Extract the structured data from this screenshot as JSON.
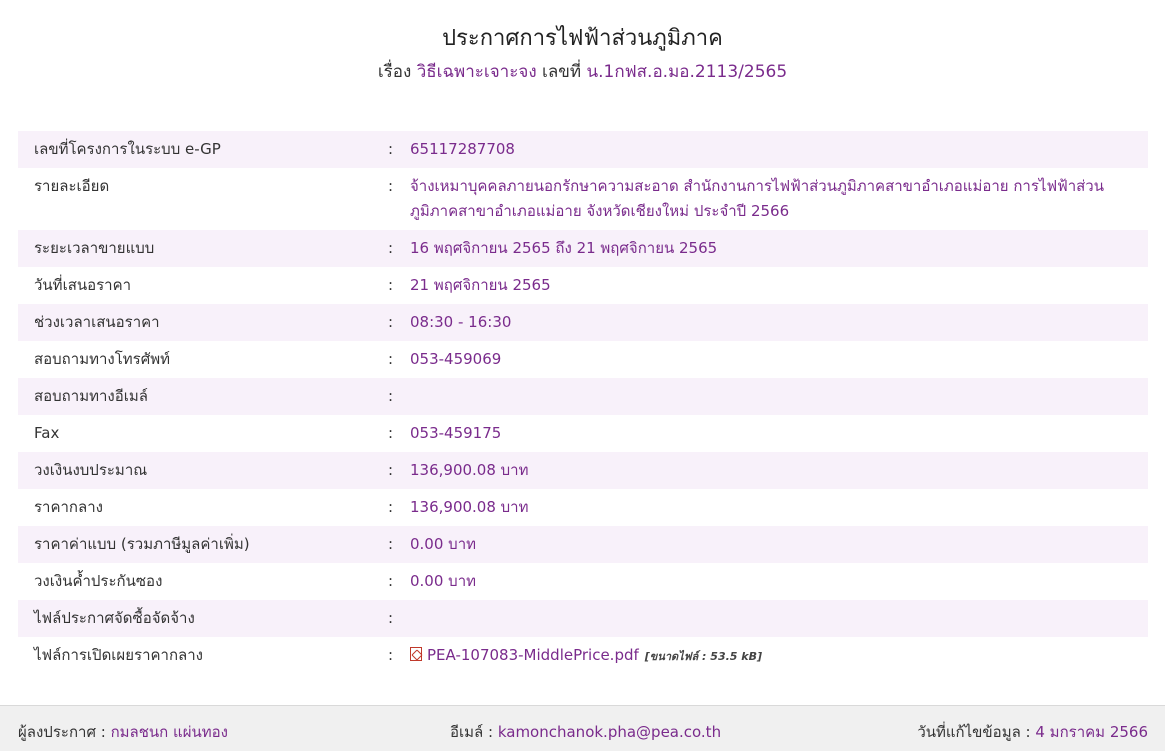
{
  "header": {
    "title": "ประกาศการไฟฟ้าส่วนภูมิภาค",
    "subject_prefix": "เรื่อง",
    "subject": "วิธีเฉพาะเจาะจง",
    "number_prefix": "เลขที่",
    "number": "น.1กฟส.อ.มอ.2113/2565"
  },
  "rows": [
    {
      "label": "เลขที่โครงการในระบบ e-GP",
      "colon": ":",
      "value": "65117287708"
    },
    {
      "label": "รายละเอียด",
      "colon": ":",
      "value": "จ้างเหมาบุคคลภายนอกรักษาความสะอาด สำนักงานการไฟฟ้าส่วนภูมิภาคสาขาอำเภอแม่อาย การไฟฟ้าส่วนภูมิภาคสาขาอำเภอแม่อาย จังหวัดเชียงใหม่ ประจำปี 2566"
    },
    {
      "label": "ระยะเวลาขายแบบ",
      "colon": ":",
      "value": "16 พฤศจิกายน 2565 ถึง 21 พฤศจิกายน 2565"
    },
    {
      "label": "วันที่เสนอราคา",
      "colon": ":",
      "value": "21 พฤศจิกายน 2565"
    },
    {
      "label": "ช่วงเวลาเสนอราคา",
      "colon": ":",
      "value": "08:30 - 16:30"
    },
    {
      "label": "สอบถามทางโทรศัพท์",
      "colon": ":",
      "value": "053-459069"
    },
    {
      "label": "สอบถามทางอีเมล์",
      "colon": ":",
      "value": ""
    },
    {
      "label": "Fax",
      "colon": ":",
      "value": "053-459175"
    },
    {
      "label": "วงเงินงบประมาณ",
      "colon": ":",
      "value": "136,900.08 บาท"
    },
    {
      "label": "ราคากลาง",
      "colon": ":",
      "value": "136,900.08 บาท"
    },
    {
      "label": "ราคาค่าแบบ (รวมภาษีมูลค่าเพิ่ม)",
      "colon": ":",
      "value": "0.00 บาท"
    },
    {
      "label": "วงเงินค้ำประกันซอง",
      "colon": ":",
      "value": "0.00 บาท"
    },
    {
      "label": "ไฟล์ประกาศจัดซื้อจัดจ้าง",
      "colon": ":",
      "value": ""
    },
    {
      "label": "ไฟล์การเปิดเผยราคากลาง",
      "colon": ":",
      "value": ""
    }
  ],
  "middle_price_file": {
    "icon": "pdf-icon",
    "name": "PEA-107083-MiddlePrice.pdf",
    "size": "[ขนาดไฟล์ : 53.5 kB]"
  },
  "footer": {
    "announcer_label": "ผู้ลงประกาศ :",
    "announcer": "กมลชนก แผ่นทอง",
    "email_label": "อีเมล์ :",
    "email": "kamonchanok.pha@pea.co.th",
    "updated_label": "วันที่แก้ไขข้อมูล :",
    "updated": "4 มกราคม 2566"
  },
  "colors": {
    "accent": "#7a2b8c",
    "row_alt": "#f8f1fa",
    "footer_bg": "#f0f0f0"
  }
}
